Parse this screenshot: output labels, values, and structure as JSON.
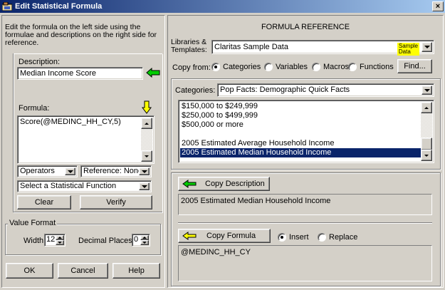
{
  "window": {
    "title": "Edit Statistical Formula",
    "close_glyph": "×"
  },
  "left": {
    "instructions": "Edit the formula on the left side using the formulae and descriptions on the right side for reference.",
    "description_label": "Description:",
    "description_value": "Median Income Score",
    "formula_label": "Formula:",
    "formula_value": "Score(@MEDINC_HH_CY,5)",
    "operators_value": "Operators",
    "reference_value": "Reference: None",
    "stat_function_value": "Select a Statistical Function",
    "clear_label": "Clear",
    "verify_label": "Verify",
    "value_format_label": "Value Format",
    "width_label": "Width:",
    "width_value": "12",
    "decimal_label": "Decimal Places:",
    "decimal_value": "0",
    "ok_label": "OK",
    "cancel_label": "Cancel",
    "help_label": "Help"
  },
  "right": {
    "header": "FORMULA REFERENCE",
    "libraries_label": "Libraries &\nTemplates:",
    "libraries_value": "Claritas Sample Data",
    "sample_badge": "Sample\nData",
    "copy_from_label": "Copy from:",
    "copy_from_options": [
      "Categories",
      "Variables",
      "Macros",
      "Functions"
    ],
    "find_label": "Find...",
    "categories_label": "Categories:",
    "categories_value": "Pop Facts: Demographic Quick Facts",
    "list_items": [
      "$150,000 to $249,999",
      "$250,000 to $499,999",
      "$500,000 or more",
      "",
      "2005 Estimated Average Household Income",
      "2005 Estimated Median Household Income"
    ],
    "copy_description_label": "Copy Description",
    "description_text": "2005 Estimated Median Household Income",
    "copy_formula_label": "Copy Formula",
    "insert_label": "Insert",
    "replace_label": "Replace",
    "formula_text": "@MEDINC_HH_CY"
  },
  "colors": {
    "arrow_green": "#00cc00",
    "arrow_yellow": "#ffff00",
    "title_blue": "#0a246a",
    "selection": "#0a246a"
  }
}
